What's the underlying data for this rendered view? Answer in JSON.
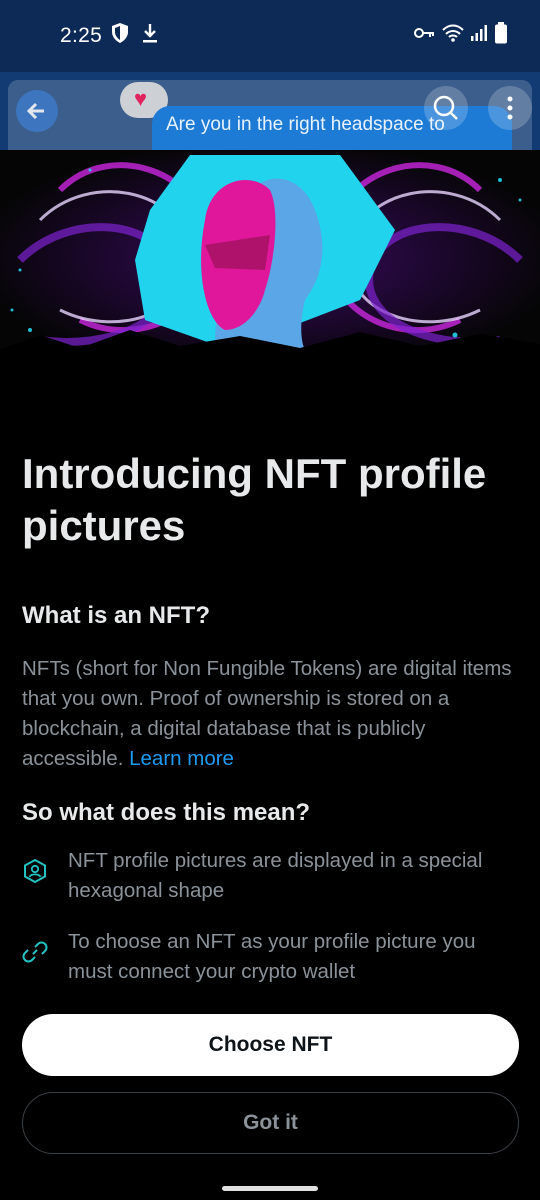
{
  "status_bar": {
    "time": "2:25",
    "icons_left": [
      "shield-icon",
      "download-icon"
    ],
    "icons_right": [
      "key-icon",
      "wifi-icon",
      "signal-icon",
      "battery-icon"
    ]
  },
  "background_app": {
    "bubble_text": "Are you in the right headspace to",
    "icons": [
      "back-arrow-icon",
      "heart-icon",
      "search-icon",
      "more-icon"
    ]
  },
  "hero": {
    "colors": {
      "cyan": "#22d3ee",
      "magenta": "#e0179b",
      "purple": "#8a2be2"
    }
  },
  "sheet": {
    "title": "Introducing NFT profile pictures",
    "what_heading": "What is an NFT?",
    "what_body": "NFTs (short for Non Fungible Tokens) are digital items that you own. Proof of ownership is stored on a blockchain, a digital database that is publicly accessible.",
    "learn_more": "Learn more",
    "meaning_heading": "So what does this mean?",
    "features": [
      {
        "icon": "hexagon-profile-icon",
        "text": "NFT profile pictures are displayed in a special hexagonal shape"
      },
      {
        "icon": "link-icon",
        "text": "To choose an NFT as your profile picture you must connect your crypto wallet"
      }
    ],
    "primary_button": "Choose NFT",
    "secondary_button": "Got it"
  },
  "colors": {
    "status_bar": "#0d2a57",
    "link": "#1d9bf0",
    "accent_teal": "#22c3c3"
  }
}
